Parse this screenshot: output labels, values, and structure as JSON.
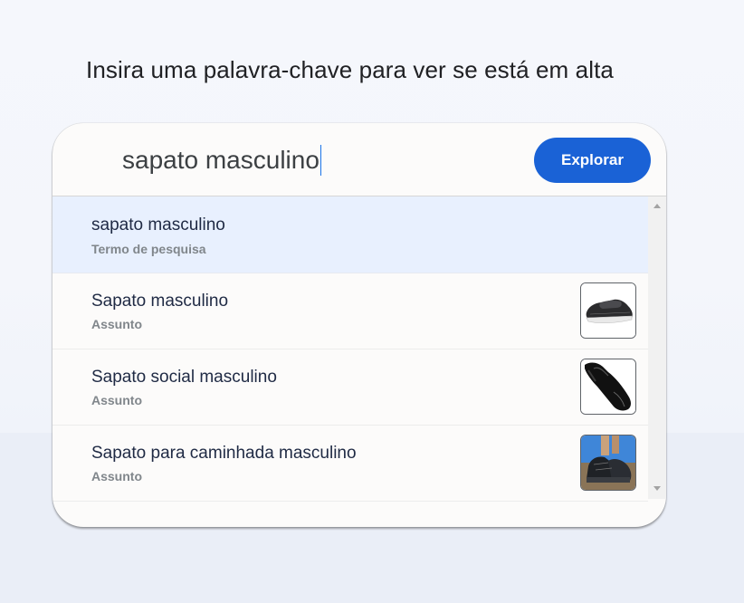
{
  "heading": "Insira uma palavra-chave para ver se está em alta",
  "search": {
    "value": "sapato masculino"
  },
  "explore_label": "Explorar",
  "suggestions": [
    {
      "title": "sapato masculino",
      "subtitle": "Termo de pesquisa"
    },
    {
      "title": "Sapato masculino",
      "subtitle": "Assunto",
      "thumbnail": "loafer-shoe-image"
    },
    {
      "title": "Sapato social masculino",
      "subtitle": "Assunto",
      "thumbnail": "dress-shoe-image"
    },
    {
      "title": "Sapato para caminhada masculino",
      "subtitle": "Assunto",
      "thumbnail": "hiking-shoe-image"
    }
  ],
  "colors": {
    "accent": "#1a62d6",
    "selected_row": "#e8f0fe"
  }
}
